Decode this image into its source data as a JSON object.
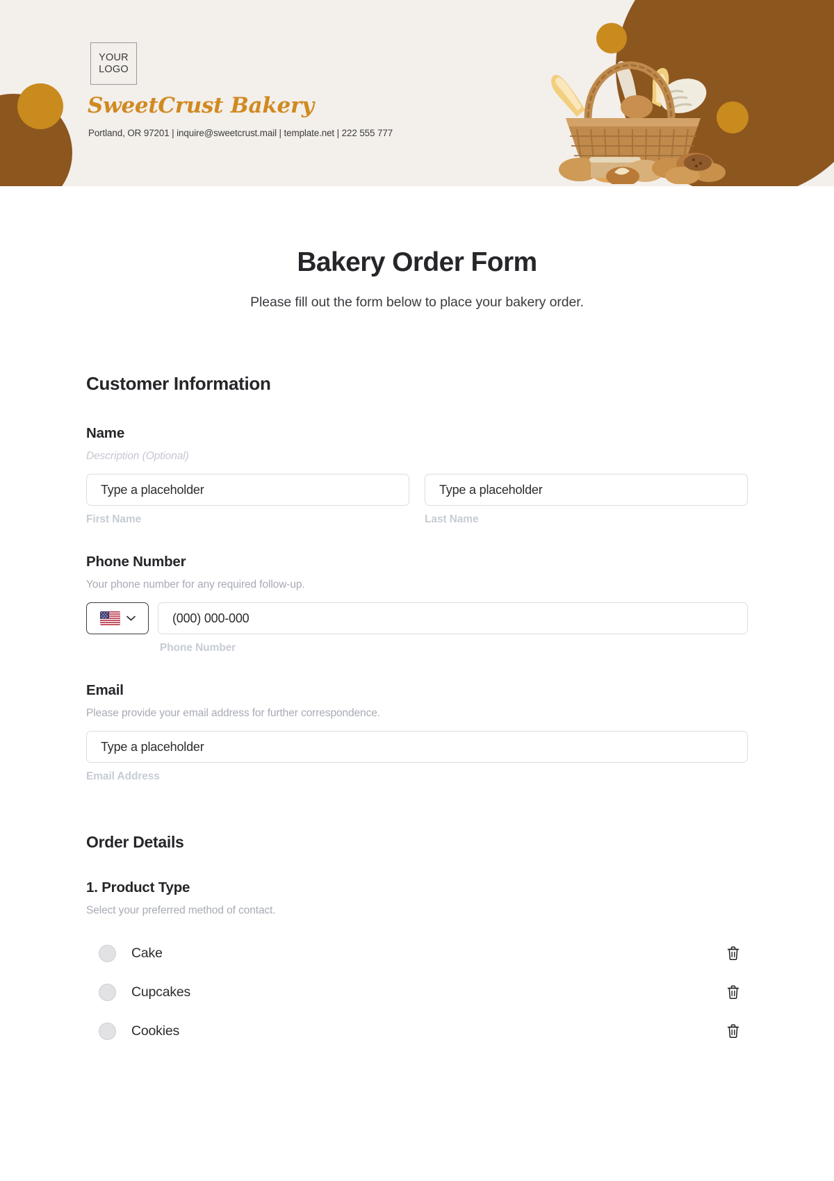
{
  "header": {
    "logo_line1": "YOUR",
    "logo_line2": "LOGO",
    "brand_name": "SweetCrust Bakery",
    "contact_line": "Portland, OR 97201 | inquire@sweetcrust.mail | template.net | 222 555 777",
    "colors": {
      "background": "#f3efeb",
      "brand_gold": "#d08a21",
      "blob_brown": "#8c561f",
      "blob_gold": "#c98a1e"
    },
    "art": "bread-basket-illustration"
  },
  "title": {
    "heading": "Bakery Order Form",
    "subheading": "Please fill out the form below to place your bakery order."
  },
  "customer_information": {
    "heading": "Customer Information",
    "name": {
      "label": "Name",
      "description": "Description (Optional)",
      "first": {
        "placeholder": "Type a placeholder",
        "value": "",
        "sub_label": "First Name"
      },
      "last": {
        "placeholder": "Type a placeholder",
        "value": "",
        "sub_label": "Last Name"
      }
    },
    "phone": {
      "label": "Phone Number",
      "description": "Your phone number for any required follow-up.",
      "country": "us-flag-icon",
      "placeholder": "(000) 000-000",
      "value": "",
      "sub_label": "Phone Number"
    },
    "email": {
      "label": "Email",
      "description": "Please provide your email address for further correspondence.",
      "placeholder": "Type a placeholder",
      "value": "",
      "sub_label": "Email Address"
    }
  },
  "order_details": {
    "heading": "Order Details",
    "product_type": {
      "label": "1. Product Type",
      "description": "Select your preferred method of contact.",
      "options": [
        {
          "label": "Cake"
        },
        {
          "label": "Cupcakes"
        },
        {
          "label": "Cookies"
        }
      ]
    }
  }
}
